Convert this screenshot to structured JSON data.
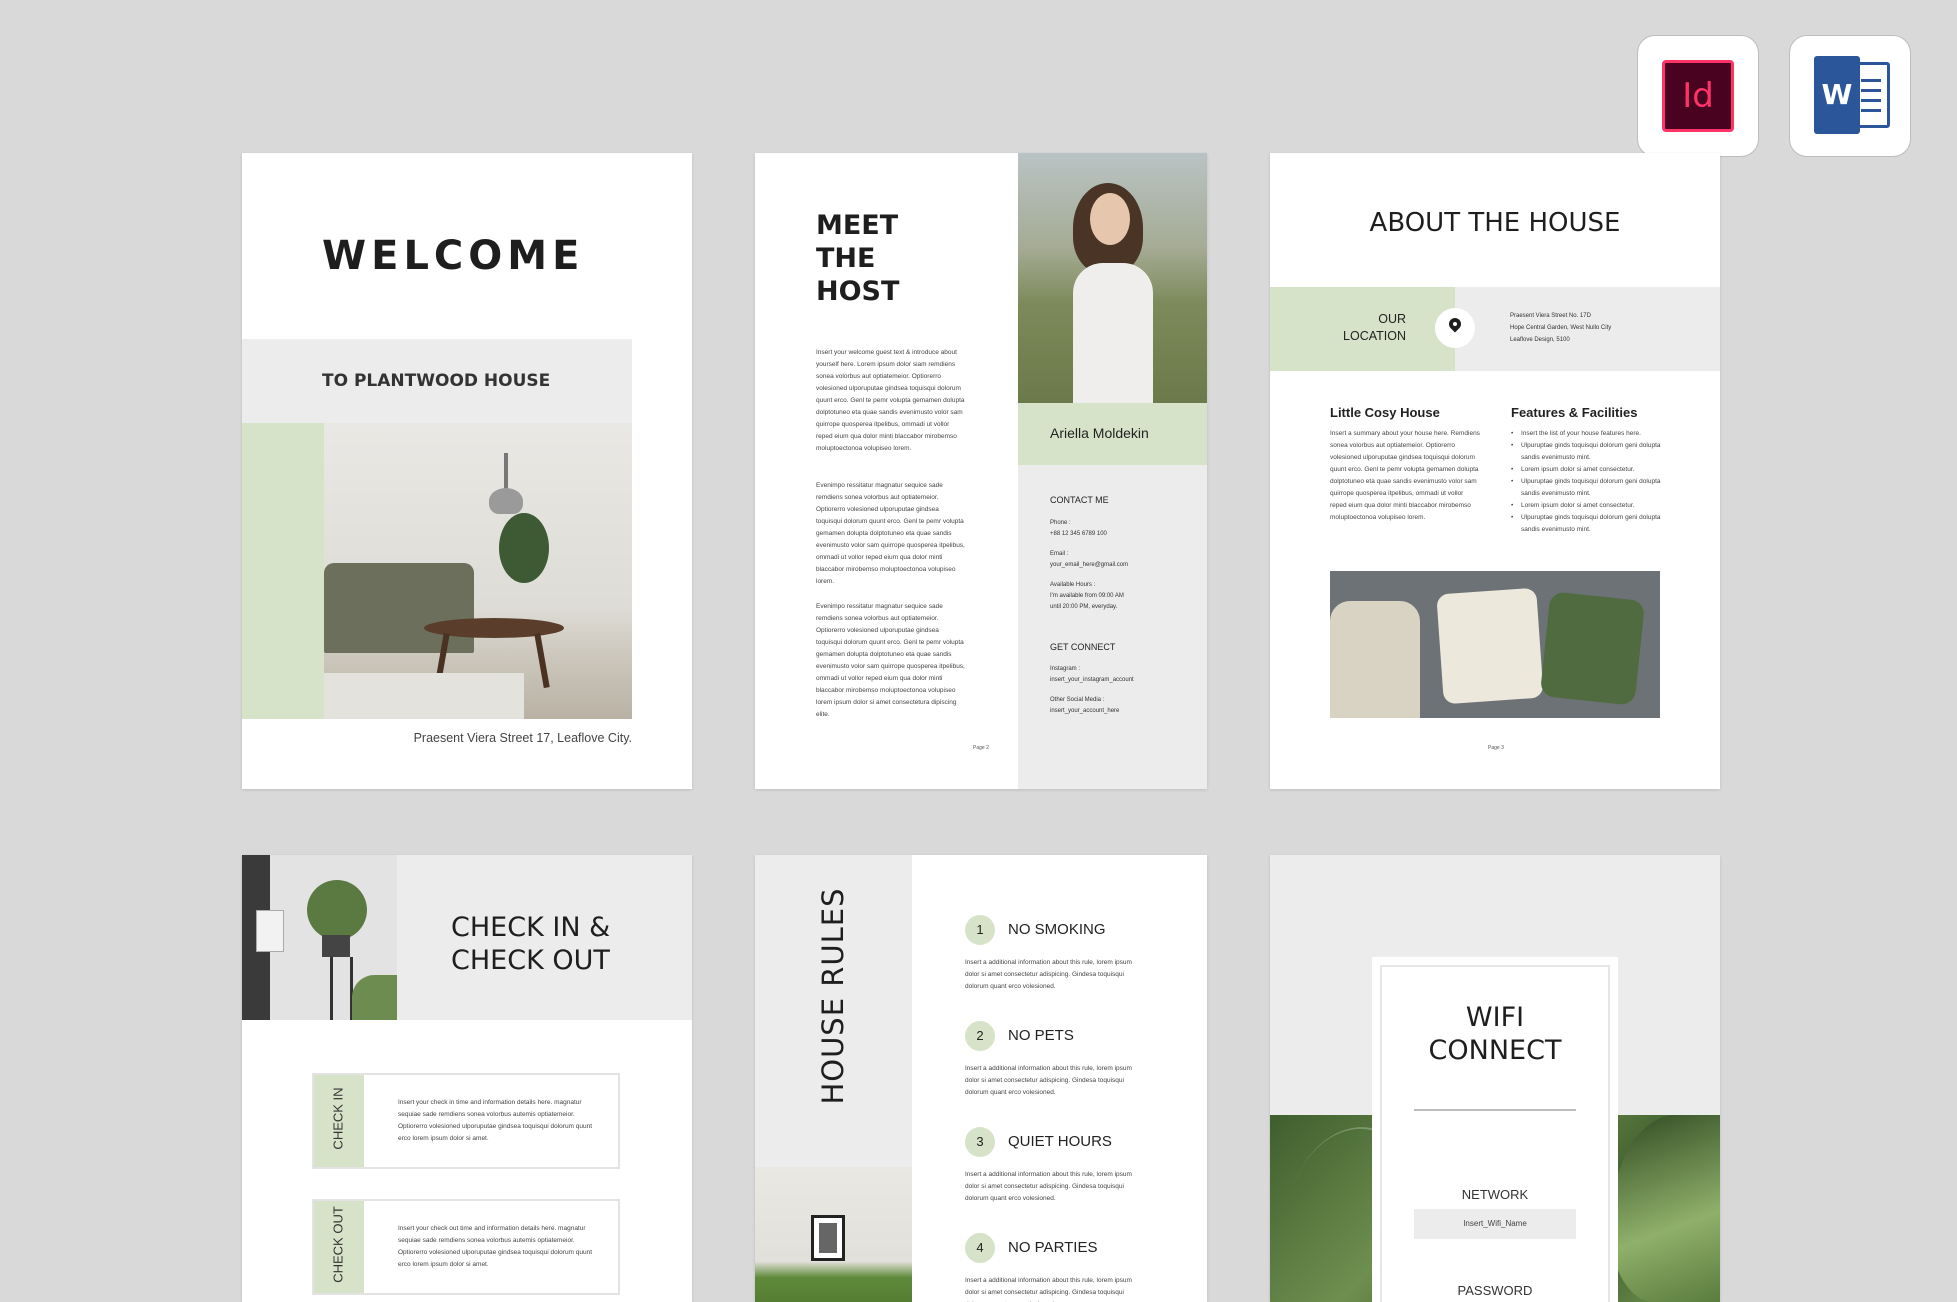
{
  "apps": {
    "indesign_label": "Id",
    "word_label": "W"
  },
  "colors": {
    "accent_green": "#d6e3c9",
    "panel_grey": "#ececec",
    "background": "#d9d9d9"
  },
  "welcome": {
    "title": "WELCOME",
    "subtitle": "TO PLANTWOOD HOUSE",
    "address": "Praesent Viera Street 17, Leaflove City."
  },
  "host": {
    "title_l1": "MEET",
    "title_l2": "THE",
    "title_l3": "HOST",
    "para1": "Insert your welcome guest text & introduce about yourself here. Lorem ipsum dolor siam remdiens sonea volorbus aut optiatemeior. Optiorerro volesioned ulporuputae gindsea toquisqui dolorum quunt erco. Genl te pemr volupta gemamen dolupta dolptotuneo eta quae sandis evenimusto volor sam quirrope quosperea itpelibus, ommadi ut vollor reped eium qua dolor minti blaccabor mirobemso moluptoectonoa volupiseo lorem.",
    "para2": "Evenimpo ressitatur magnatur sequice sade remdiens sonea volorbus aut optiatemeior. Optiorerro volesioned ulporuputae gindsea toquisqui dolorum quunt erco. Genl te pemr volupta gemamen dolupta dolptotuneo eta quae sandis evenimusto volor sam quirrope quosperea itpelibus, ommadi ut vollor reped eium qua dolor minti blaccabor mirobemso moluptoectonoa volupiseo lorem.",
    "para3": "Evenimpo ressitatur magnatur sequice sade remdiens sonea volorbus aut optiatemeior. Optiorerro volesioned ulporuputae gindsea toquisqui dolorum quunt erco. Genl te pemr volupta gemamen dolupta dolptotuneo eta quae sandis evenimusto volor sam quirrope quosperea itpelibus, ommadi ut vollor reped eium qua dolor minti blaccabor mirobemso moluptoectonoa volupiseo lorem ipsum dolor si amet consectetura dipiscing elite.",
    "page": "Page 2",
    "name": "Ariella Moldekin",
    "contact_heading": "CONTACT ME",
    "phone_label": "Phone :",
    "phone": "+88 12 345 6789 100",
    "email_label": "Email :",
    "email": "your_email_here@gmail.com",
    "hours_label": "Available Hours :",
    "hours1": "I'm available from 09:00 AM",
    "hours2": "until 20:00 PM, everyday.",
    "connect_heading": "GET CONNECT",
    "insta_label": "Instagram :",
    "insta": "insert_your_instagram_account",
    "social_label": "Other Social Media :",
    "social": "insert_your_account_here"
  },
  "about": {
    "title": "ABOUT THE HOUSE",
    "loc_l1": "OUR",
    "loc_l2": "LOCATION",
    "addr1": "Praesent Viera Street No. 17D",
    "addr2": "Hope Central Garden, West Nullo City",
    "addr3": "Leaflove Design, 5100",
    "cosy_title": "Little Cosy House",
    "cosy_text": "Insert a summary about your house here. Remdiens sonea volorbus aut optiatemeior. Optiorerro volesioned ulporuputae gindsea toquisqui dolorum quunt erco. Genl te pemr volupta gemamen dolupta dolptotuneo eta quae sandis evenimusto volor sam quirrope quosperea itpelibus, ommadi ut vollor reped eium qua dolor minti blaccabor mirobemso moluptoectonoa volupiseo lorem.",
    "features_title": "Features & Facilities",
    "features": [
      "Insert the list of your house features here.",
      "Ulpuruptae ginds toquisqui dolorum geni dolupta sandis evenimusto mint.",
      "Lorem ipsum dolor si amet consectetur.",
      "Ulpuruptae ginds toquisqui dolorum geni dolupta sandis evenimusto mint.",
      "Lorem ipsum dolor si amet consectetur.",
      "Ulpuruptae ginds toquisqui dolorum geni dolupta sandis evenimusto mint."
    ],
    "page": "Page 3"
  },
  "checkin": {
    "title_l1": "CHECK IN &",
    "title_l2": "CHECK OUT",
    "in_label": "CHECK IN",
    "in_text": "Insert your check in time and information details here. magnatur sequiae sade remdiens sonea volorbus autemis optiatemeior. Optiorerro volesioned ulporuputae gindsea toquisqui dolorum quunt erco lorem ipsum dolor si amet.",
    "out_label": "CHECK OUT",
    "out_text": "Insert your check out time and information details here. magnatur sequiae sade remdiens sonea volorbus autemis optiatemeior. Optiorerro volesioned ulporuputae gindsea toquisqui dolorum quunt erco lorem ipsum dolor si amet."
  },
  "rules": {
    "title": "HOUSE RULES",
    "items": [
      {
        "num": "1",
        "title": "NO SMOKING",
        "text": "Insert a additional information about this rule, lorem ipsum dolor si amet consectetur adispicing. Gindesa toquisqui dolorum quant erco volesioned."
      },
      {
        "num": "2",
        "title": "NO PETS",
        "text": "Insert a additional information about this rule, lorem ipsum dolor si amet consectetur adispicing. Gindesa toquisqui dolorum quant erco volesioned."
      },
      {
        "num": "3",
        "title": "QUIET HOURS",
        "text": "Insert a additional information about this rule, lorem ipsum dolor si amet consectetur adispicing. Gindesa toquisqui dolorum quant erco volesioned."
      },
      {
        "num": "4",
        "title": "NO PARTIES",
        "text": "Insert a additional information about this rule, lorem ipsum dolor si amet consectetur adispicing. Gindesa toquisqui dolorum quant erco volesioned."
      }
    ]
  },
  "wifi": {
    "title_l1": "WIFI",
    "title_l2": "CONNECT",
    "network_label": "NETWORK",
    "network_value": "Insert_Wifi_Name",
    "password_label": "PASSWORD"
  }
}
